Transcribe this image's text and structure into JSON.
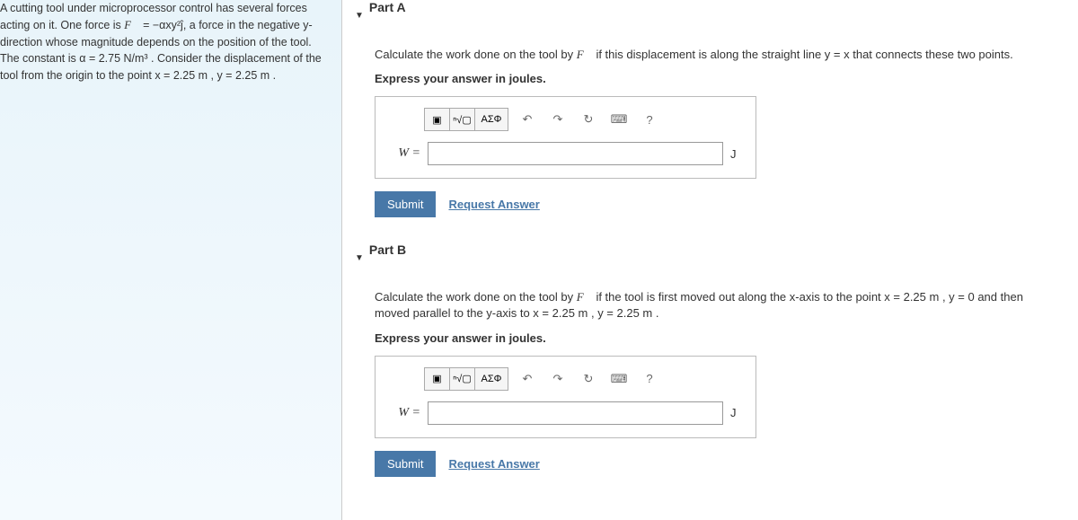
{
  "problem": {
    "text_parts": [
      "A cutting tool under microprocessor control has several forces acting on it. One force is ",
      " = −αxy²ĵ, a force in the negative y-direction whose magnitude depends on the position of the tool. The constant is α = 2.75 N/m³ . Consider the displacement of the tool from the origin to the point x = 2.25 m , y = 2.25 m ."
    ],
    "force_symbol": "F⃗"
  },
  "parts": {
    "A": {
      "title": "Part A",
      "prompt_pre": "Calculate the work done on the tool by ",
      "prompt_force": "F⃗",
      "prompt_post": " if this displacement is along the straight line y = x that connects these two points.",
      "instruction": "Express your answer in joules.",
      "var": "W =",
      "unit": "J",
      "submit": "Submit",
      "request": "Request Answer"
    },
    "B": {
      "title": "Part B",
      "prompt_pre": "Calculate the work done on the tool by ",
      "prompt_force": "F⃗",
      "prompt_post": " if the tool is first moved out along the x-axis to the point x = 2.25 m , y = 0 and then moved parallel to the y-axis to x = 2.25 m , y = 2.25 m .",
      "instruction": "Express your answer in joules.",
      "var": "W =",
      "unit": "J",
      "submit": "Submit",
      "request": "Request Answer"
    }
  },
  "toolbar": {
    "template": "▣",
    "sqrt": "ⁿ√▢",
    "greek": "ΑΣΦ",
    "undo": "↶",
    "redo": "↷",
    "reset": "↻",
    "keyboard": "⌨",
    "help": "?"
  }
}
